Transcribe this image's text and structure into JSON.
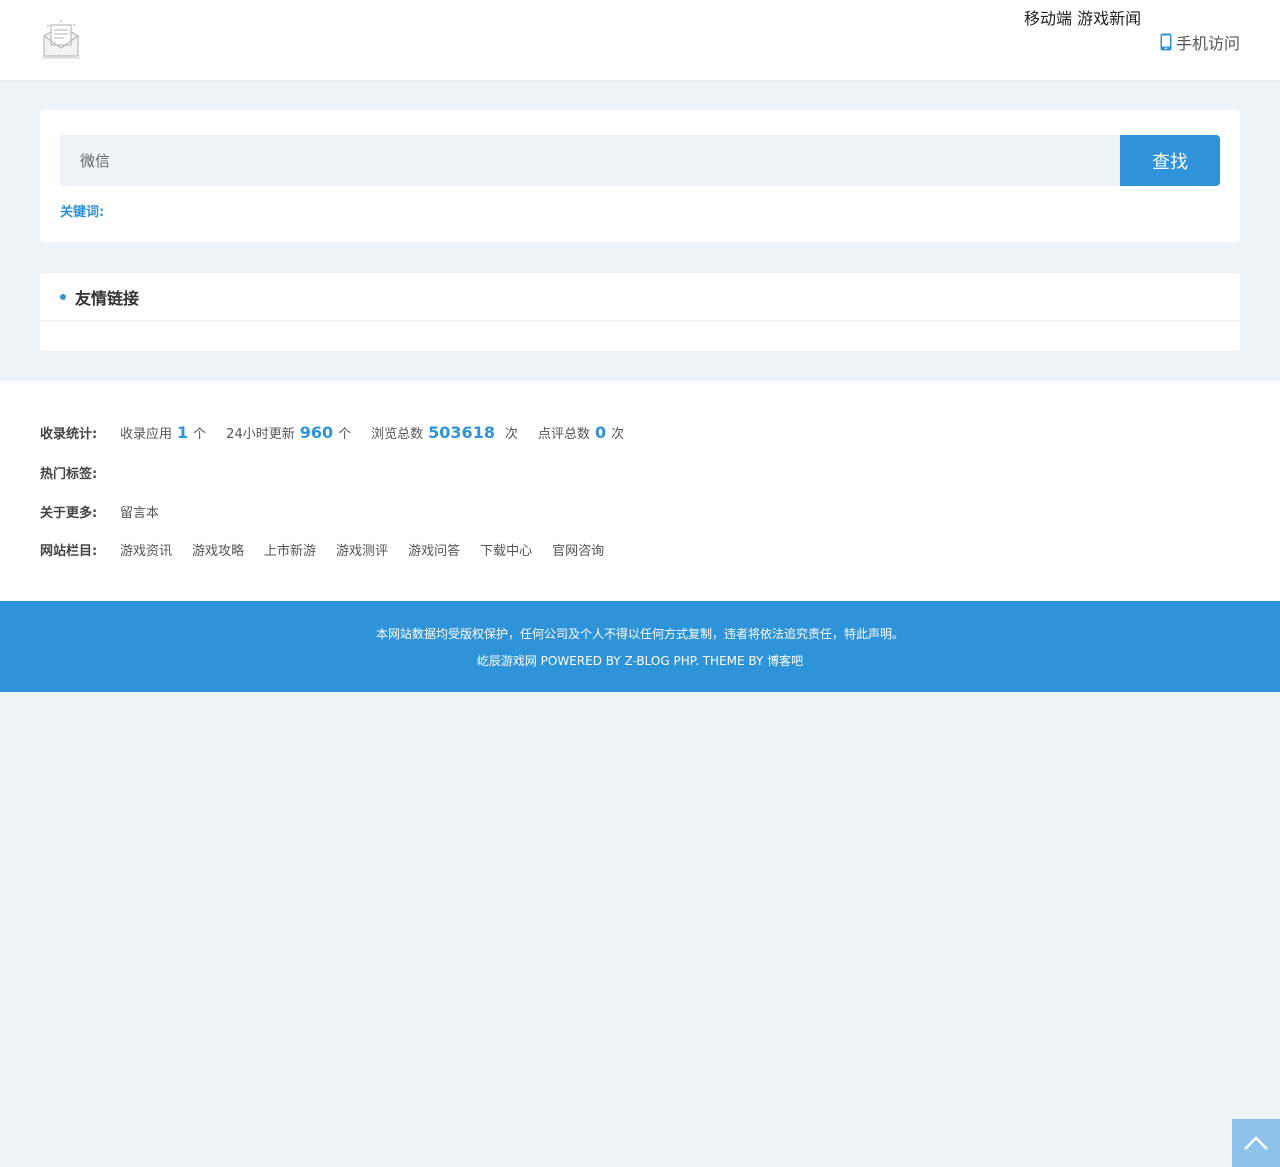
{
  "header": {
    "mobile_title": "移动端 游戏新闻",
    "mobile_link_label": "手机访问",
    "icons": {
      "logo": "envelope-doc-icon",
      "phone": "phone-icon"
    }
  },
  "search": {
    "value": "微信",
    "button_label": "查找",
    "keywords_label": "关键词:"
  },
  "friend_links": {
    "title": "友情链接"
  },
  "stats": {
    "label": "收录统计:",
    "items": [
      {
        "prefix": "收录应用",
        "value": "1",
        "unit": "个"
      },
      {
        "prefix": "24小时更新",
        "value": "960",
        "unit": "个"
      },
      {
        "prefix": "浏览总数",
        "value": "503618",
        "unit": "次"
      },
      {
        "prefix": "点评总数",
        "value": "0",
        "unit": "次"
      }
    ]
  },
  "hot_tags": {
    "label": "热门标签:"
  },
  "about": {
    "label": "关于更多:",
    "items": [
      "留言本"
    ]
  },
  "columns": {
    "label": "网站栏目:",
    "items": [
      "游戏资讯",
      "游戏攻略",
      "上市新游",
      "游戏测评",
      "游戏问答",
      "下载中心",
      "官网咨询"
    ]
  },
  "footer": {
    "notice": "本网站数据均受版权保护，任何公司及个人不得以任何方式复制，违者将依法追究责任，特此声明。",
    "credit": "屹辰游戏网 POWERED BY Z-BLOG PHP. THEME BY 博客吧"
  },
  "colors": {
    "accent": "#2e93d8",
    "page_bg": "#eef3f9",
    "to_top_bg": "#8fc2ea"
  }
}
